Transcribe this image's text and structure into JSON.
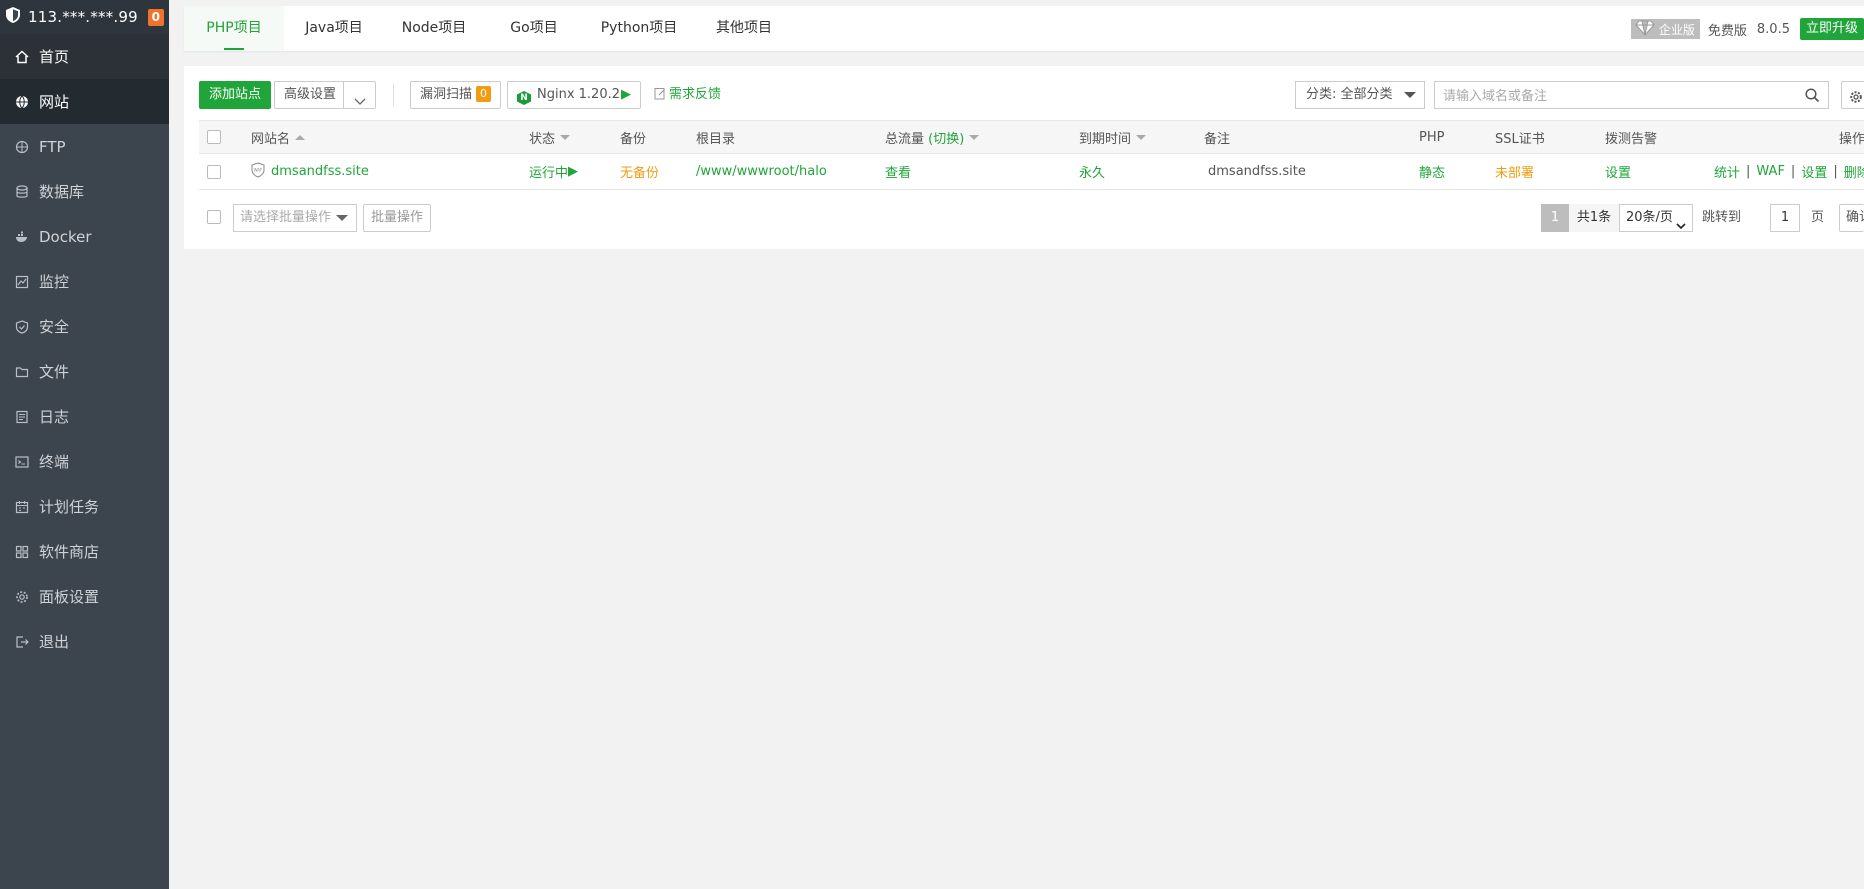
{
  "sidebar": {
    "server_ip": "113.***.***.99",
    "alert_count": "0",
    "items": [
      {
        "label": "首页"
      },
      {
        "label": "网站"
      },
      {
        "label": "FTP"
      },
      {
        "label": "数据库"
      },
      {
        "label": "Docker"
      },
      {
        "label": "监控"
      },
      {
        "label": "安全"
      },
      {
        "label": "文件"
      },
      {
        "label": "日志"
      },
      {
        "label": "终端"
      },
      {
        "label": "计划任务"
      },
      {
        "label": "软件商店"
      },
      {
        "label": "面板设置"
      },
      {
        "label": "退出"
      }
    ]
  },
  "tabs": [
    "PHP项目",
    "Java项目",
    "Node项目",
    "Go项目",
    "Python项目",
    "其他项目"
  ],
  "header": {
    "enterprise": "企业版",
    "free": "免费版",
    "version": "8.0.5",
    "upgrade": "立即升级"
  },
  "toolbar": {
    "add_site": "添加站点",
    "advanced": "高级设置",
    "vuln_scan": "漏洞扫描",
    "vuln_count": "0",
    "nginx": "Nginx 1.20.2",
    "feedback": "需求反馈",
    "category": "分类: 全部分类",
    "search_placeholder": "请输入域名或备注"
  },
  "table": {
    "headers": {
      "name": "网站名",
      "status": "状态",
      "backup": "备份",
      "root": "根目录",
      "traffic": "总流量",
      "traffic_switch": "(切换)",
      "expire": "到期时间",
      "remark": "备注",
      "php": "PHP",
      "ssl": "SSL证书",
      "monitor": "拨测告警",
      "ops": "操作"
    },
    "rows": [
      {
        "name": "dmsandfss.site",
        "status": "运行中",
        "backup": "无备份",
        "root": "/www/wwwroot/halo",
        "traffic": "查看",
        "expire": "永久",
        "remark": "dmsandfss.site",
        "php": "静态",
        "ssl": "未部署",
        "monitor": "设置",
        "ops": [
          "统计",
          "WAF",
          "设置",
          "删除"
        ]
      }
    ]
  },
  "footer": {
    "batch_placeholder": "请选择批量操作",
    "batch_button": "批量操作",
    "current_page": "1",
    "total": "共1条",
    "page_size": "20条/页",
    "jump_label": "跳转到",
    "jump_value": "1",
    "page_unit": "页",
    "confirm": "确认"
  },
  "colors": {
    "accent": "#20a53a",
    "sidebar_bg": "#3c444d",
    "badge": "#f0722b",
    "warning": "#f39c12"
  }
}
